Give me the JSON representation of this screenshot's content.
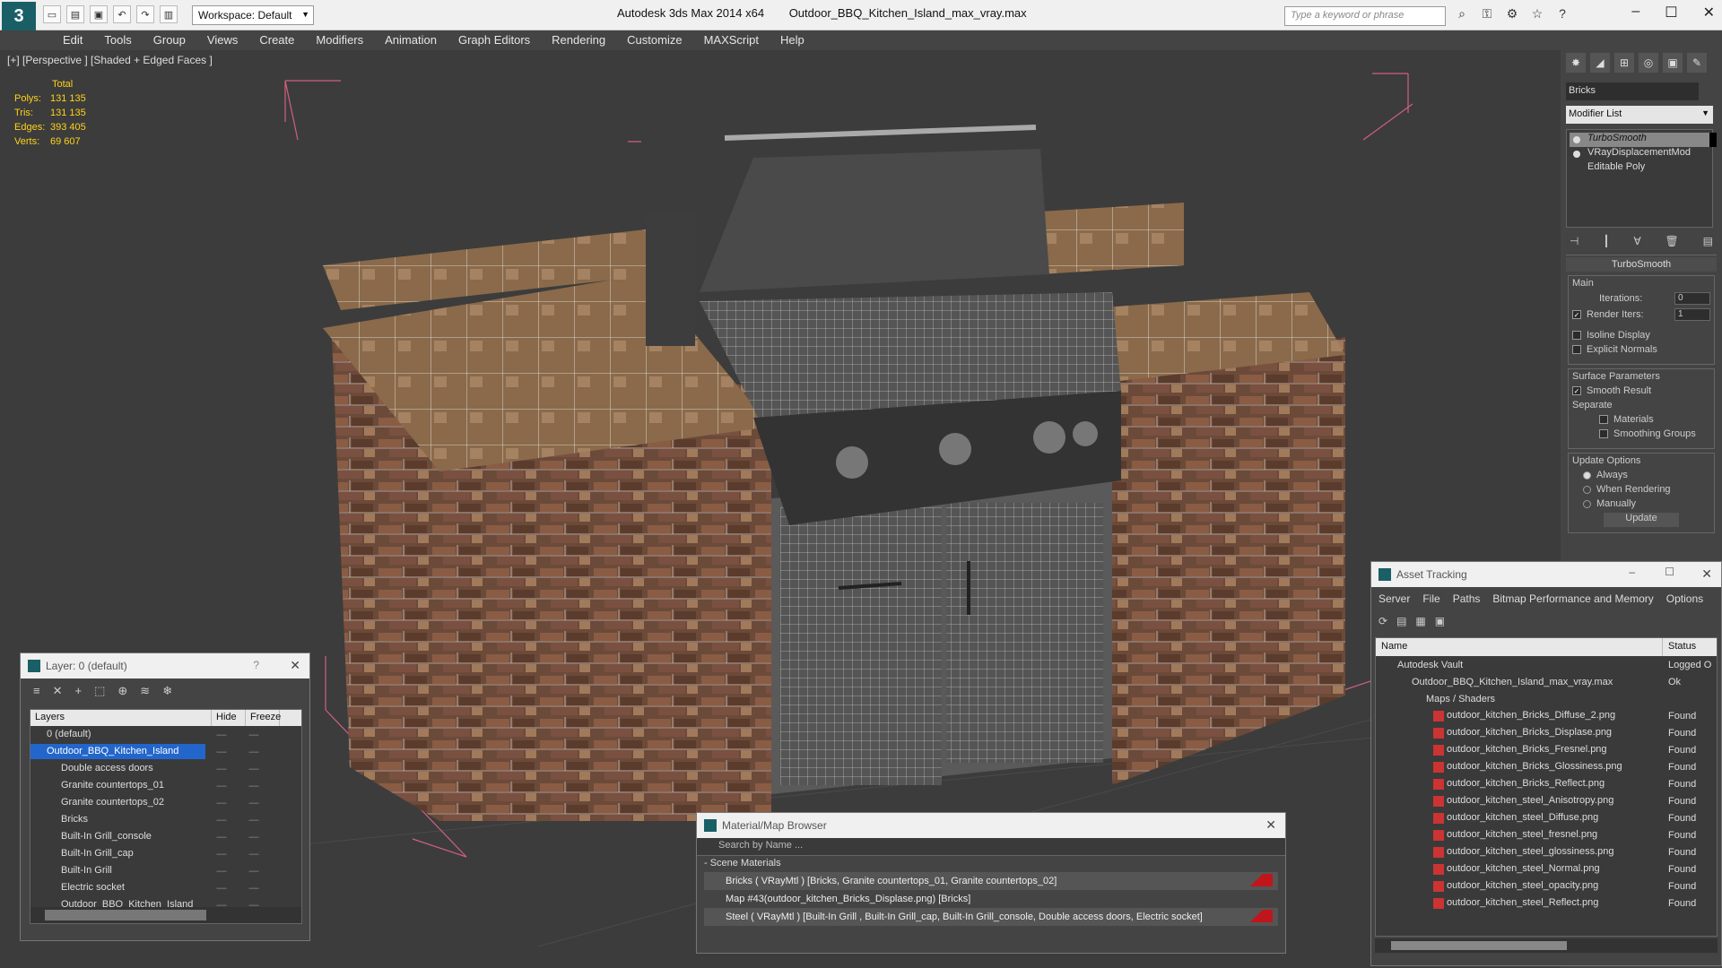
{
  "app": {
    "name": "Autodesk 3ds Max  2014 x64",
    "file": "Outdoor_BBQ_Kitchen_Island_max_vray.max",
    "workspace": "Workspace: Default",
    "search_placeholder": "Type a keyword or phrase"
  },
  "menu": [
    "Edit",
    "Tools",
    "Group",
    "Views",
    "Create",
    "Modifiers",
    "Animation",
    "Graph Editors",
    "Rendering",
    "Customize",
    "MAXScript",
    "Help"
  ],
  "viewport": {
    "label": "[+] [Perspective ] [Shaded + Edged Faces ]",
    "stats_header": "Total",
    "stats": [
      {
        "k": "Polys:",
        "v": "131 135"
      },
      {
        "k": "Tris:",
        "v": "131 135"
      },
      {
        "k": "Edges:",
        "v": "393 405"
      },
      {
        "k": "Verts:",
        "v": "69 607"
      }
    ]
  },
  "command_panel": {
    "object_name": "Bricks",
    "object_color": "#000000",
    "modifier_list": "Modifier List",
    "stack": [
      "TurboSmooth",
      "VRayDisplacementMod",
      "Editable Poly"
    ],
    "rollout": "TurboSmooth",
    "main_label": "Main",
    "iterations_label": "Iterations:",
    "iterations": "0",
    "render_iters_label": "Render Iters:",
    "render_iters": "1",
    "isoline": "Isoline Display",
    "explicit": "Explicit Normals",
    "surface_label": "Surface Parameters",
    "smooth_result": "Smooth Result",
    "separate": "Separate",
    "materials": "Materials",
    "smoothing_groups": "Smoothing Groups",
    "update_options": "Update Options",
    "always": "Always",
    "when_rendering": "When Rendering",
    "manually": "Manually",
    "update": "Update"
  },
  "layers": {
    "title": "Layer: 0 (default)",
    "col_layers": "Layers",
    "col_hide": "Hide",
    "col_freeze": "Freeze",
    "rows": [
      "0 (default)",
      "Outdoor_BBQ_Kitchen_Island",
      "Double access doors",
      "Granite countertops_01",
      "Granite countertops_02",
      "Bricks",
      "Built-In Grill_console",
      "Built-In Grill_cap",
      "Built-In Grill",
      "Electric socket",
      "Outdoor_BBQ_Kitchen_Island"
    ]
  },
  "assets": {
    "title": "Asset Tracking",
    "menu": [
      "Server",
      "File",
      "Paths",
      "Bitmap Performance and Memory",
      "Options"
    ],
    "col_name": "Name",
    "col_status": "Status",
    "rows": [
      {
        "name": "Autodesk Vault",
        "status": "Logged O"
      },
      {
        "name": "Outdoor_BBQ_Kitchen_Island_max_vray.max",
        "status": "Ok"
      },
      {
        "name": "Maps / Shaders",
        "status": ""
      },
      {
        "name": "outdoor_kitchen_Bricks_Diffuse_2.png",
        "status": "Found"
      },
      {
        "name": "outdoor_kitchen_Bricks_Displase.png",
        "status": "Found"
      },
      {
        "name": "outdoor_kitchen_Bricks_Fresnel.png",
        "status": "Found"
      },
      {
        "name": "outdoor_kitchen_Bricks_Glossiness.png",
        "status": "Found"
      },
      {
        "name": "outdoor_kitchen_Bricks_Reflect.png",
        "status": "Found"
      },
      {
        "name": "outdoor_kitchen_steel_Anisotropy.png",
        "status": "Found"
      },
      {
        "name": "outdoor_kitchen_steel_Diffuse.png",
        "status": "Found"
      },
      {
        "name": "outdoor_kitchen_steel_fresnel.png",
        "status": "Found"
      },
      {
        "name": "outdoor_kitchen_steel_glossiness.png",
        "status": "Found"
      },
      {
        "name": "outdoor_kitchen_steel_Normal.png",
        "status": "Found"
      },
      {
        "name": "outdoor_kitchen_steel_opacity.png",
        "status": "Found"
      },
      {
        "name": "outdoor_kitchen_steel_Reflect.png",
        "status": "Found"
      }
    ]
  },
  "material_browser": {
    "title": "Material/Map Browser",
    "search": "Search by Name ...",
    "category": "- Scene Materials",
    "rows": [
      "Bricks  ( VRayMtl )  [Bricks, Granite countertops_01, Granite countertops_02]",
      "Map #43(outdoor_kitchen_Bricks_Displase.png) [Bricks]",
      "Steel  ( VRayMtl )  [Built-In Grill , Built-In Grill_cap, Built-In Grill_console, Double access doors, Electric socket]"
    ]
  }
}
